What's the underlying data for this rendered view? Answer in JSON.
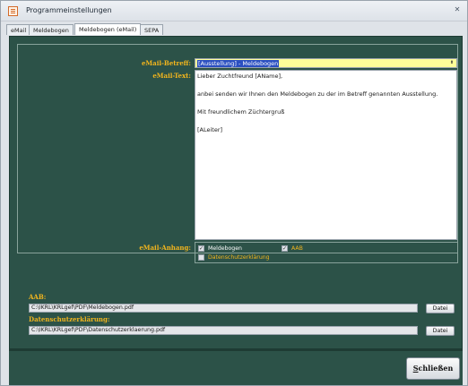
{
  "window": {
    "title": "Programmeinstellungen",
    "icon": "form-icon",
    "close_icon": "close-icon"
  },
  "tabs": [
    {
      "label": "eMail",
      "active": false
    },
    {
      "label": "Meldebogen",
      "active": false
    },
    {
      "label": "Meldebogen (eMail)",
      "active": true
    },
    {
      "label": "SEPA",
      "active": false
    }
  ],
  "form": {
    "subject_label": "eMail-Betreff:",
    "subject_value": "[Ausstellung] - Meldebogen",
    "body_label": "eMail-Text:",
    "body_lines": [
      "Lieber Zuchtfreund [AName],",
      "anbei senden wir Ihnen den Meldebogen zu der im Betreff genannten Ausstellung.",
      "Mit freundlichem Züchtergruß",
      "[ALeiter]"
    ],
    "attachment_label": "eMail-Anhang:",
    "attachments": [
      {
        "label": "Meldebogen",
        "checked": true
      },
      {
        "label": "AAB",
        "checked": true
      },
      {
        "label": "Datenschutzerklärung",
        "checked": false
      }
    ],
    "aab_label": "AAB:",
    "aab_path": "C:\\IKRL\\KRLgef\\PDF\\Meldebogen.pdf",
    "privacy_label": "Datenschutzerklärung:",
    "privacy_path": "C:\\IKRL\\KRLgef\\PDF\\Datenschutzerklaerung.pdf",
    "file_button_label": "Datei"
  },
  "footer": {
    "close_button_label": "Schließen",
    "close_button_accesskey": "S",
    "close_button_rest": "chließen"
  },
  "colors": {
    "panel": "#2c5248",
    "label": "#f2b51d",
    "subject_bg": "#ffff99",
    "selection": "#2b4fc1"
  }
}
